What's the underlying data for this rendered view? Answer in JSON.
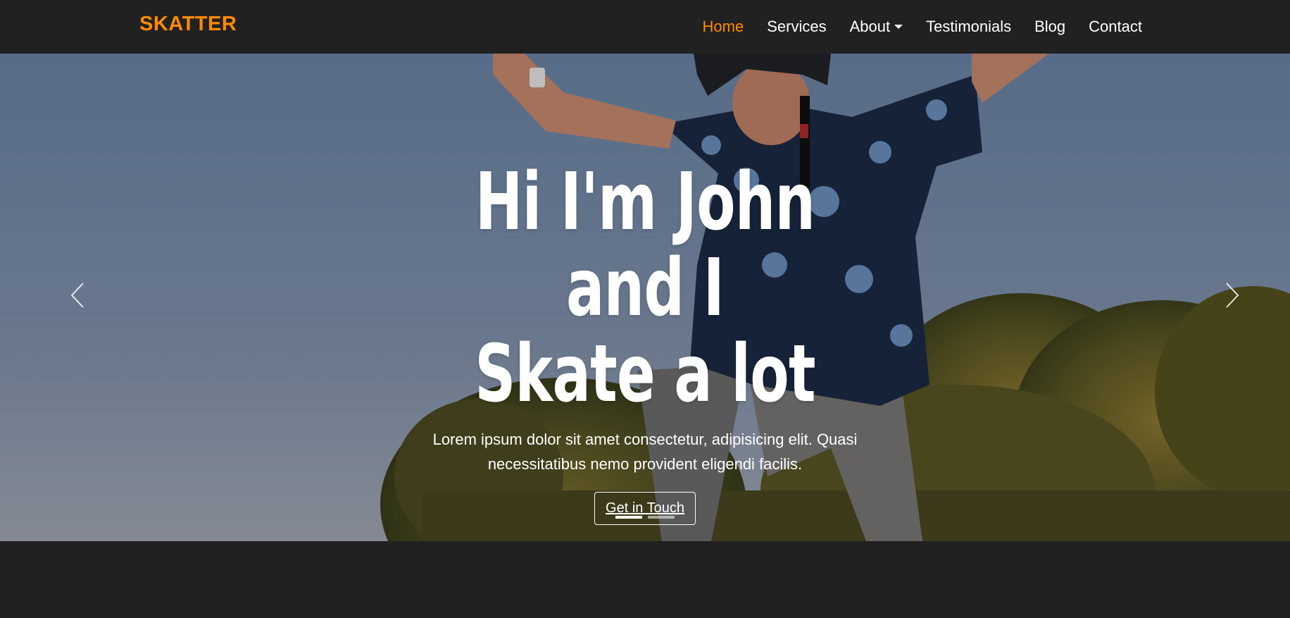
{
  "nav": {
    "brand": "SKATTER",
    "items": [
      {
        "label": "Home",
        "active": true
      },
      {
        "label": "Services",
        "active": false
      },
      {
        "label": "About",
        "active": false,
        "dropdown": true
      },
      {
        "label": "Testimonials",
        "active": false
      },
      {
        "label": "Blog",
        "active": false
      },
      {
        "label": "Contact",
        "active": false
      }
    ]
  },
  "hero": {
    "title_line1": "Hi I'm John and I",
    "title_line2": "Skate a lot",
    "subtitle": "Lorem ipsum dolor sit amet consectetur, adipisicing elit. Quasi necessitatibus nemo provident eligendi facilis.",
    "button_label": "Get in Touch",
    "prev_icon": "chevron-left-icon",
    "next_icon": "chevron-right-icon",
    "slides_total": 2,
    "active_slide": 1
  },
  "colors": {
    "accent": "#ff8a00",
    "nav_bg": "#212121",
    "text": "#ffffff"
  }
}
